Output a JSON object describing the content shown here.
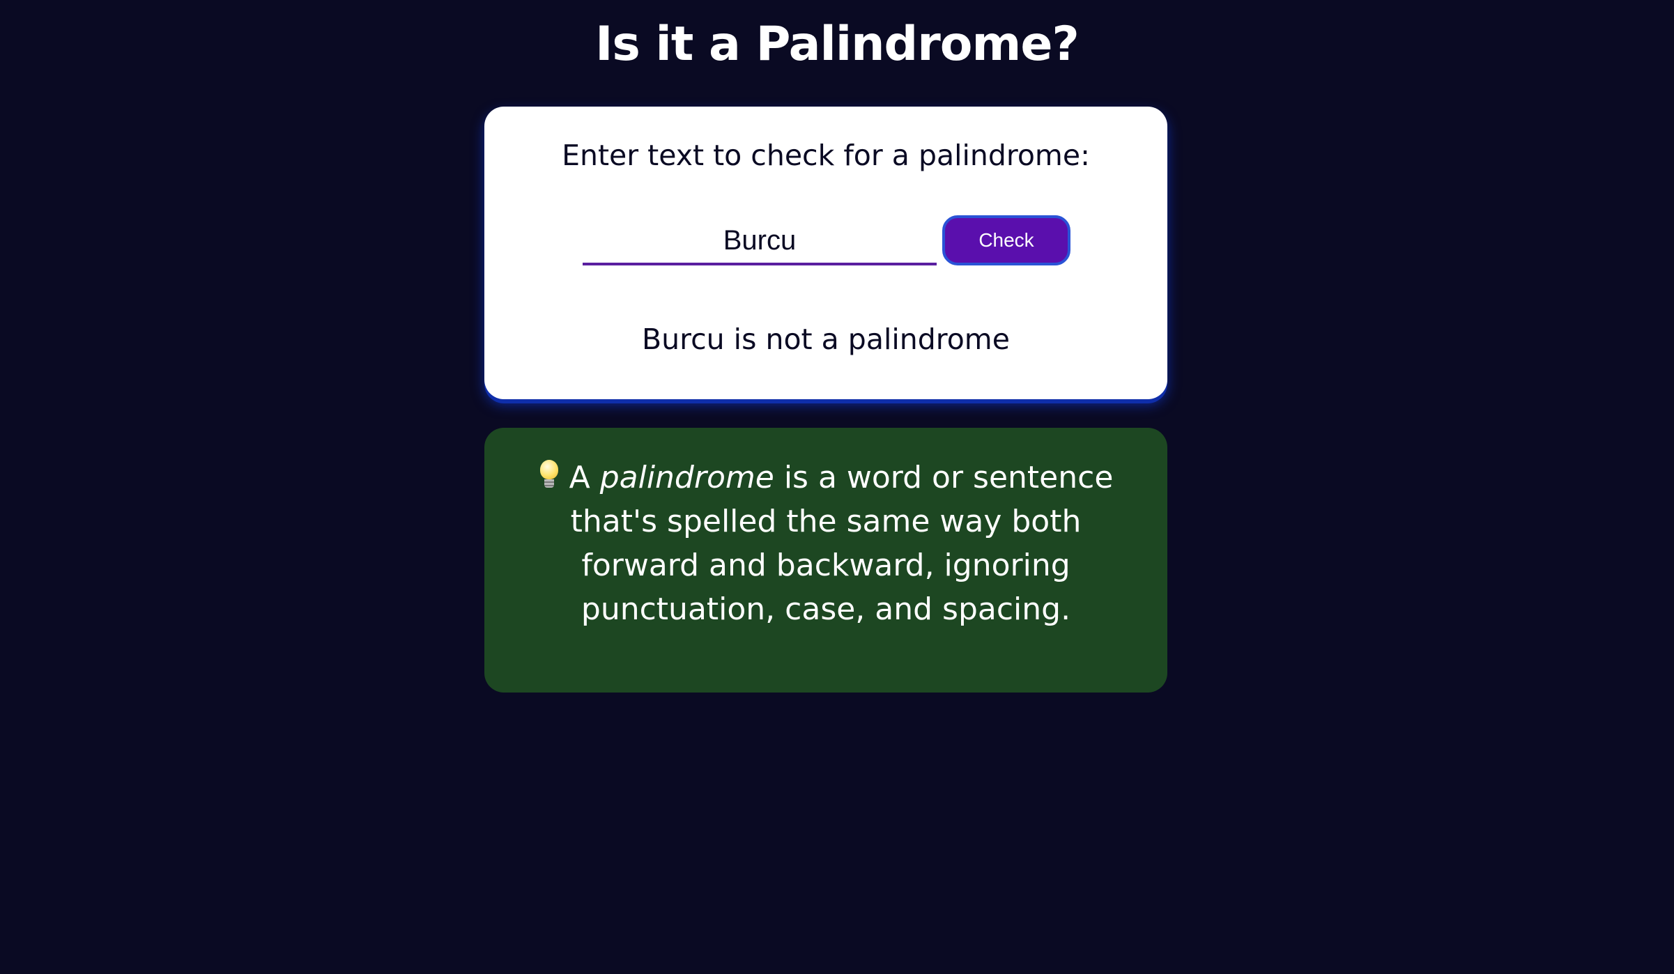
{
  "page": {
    "title": "Is it a Palindrome?"
  },
  "checker": {
    "label": "Enter text to check for a palindrome:",
    "input_value": "Burcu",
    "button_label": "Check",
    "result": "Burcu is not a palindrome"
  },
  "info": {
    "icon": "light-bulb-icon",
    "lead": "A",
    "term": "palindrome",
    "definition": "is a word or sentence that's spelled the same way both forward and backward, ignoring punctuation, case, and spacing."
  },
  "colors": {
    "background": "#0a0a23",
    "card": "#ffffff",
    "card_glow": "#0f2eaa",
    "button": "#5a0fad",
    "button_border": "#2a53d6",
    "input_underline": "#5a1fa0",
    "info_card": "#1d4722"
  }
}
